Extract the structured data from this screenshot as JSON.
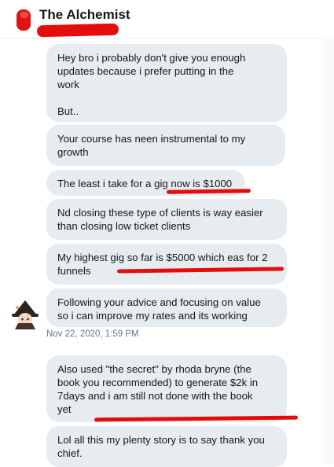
{
  "header": {
    "title": "The Alchemist"
  },
  "messages": [
    {
      "lines": [
        "Hey bro i probably  don't  give you enough",
        "updates  because  i prefer putting  in the",
        "work"
      ],
      "extra": [
        "But.."
      ]
    },
    {
      "lines": [
        "Your course has neen instrumental  to my",
        "growth"
      ]
    },
    {
      "lines": [
        "The least i take for a gig now is $1000"
      ]
    },
    {
      "lines": [
        "Nd closing  these type of clients is way easier",
        "than closing  low ticket clients"
      ]
    },
    {
      "lines": [
        "My highest gig so far is $5000 which eas for 2",
        "funnels"
      ]
    },
    {
      "lines": [
        "Following  your advice and focusing  on value",
        "so i can improve my rates  and its working"
      ]
    },
    {
      "lines": [
        "Also used  \"the secret\" by rhoda bryne (the",
        "book you recommended) to generate $2k in",
        "7days and i am still  not done  with the book",
        "yet"
      ]
    },
    {
      "lines": [
        "Lol all this my plenty story is to say thank  you",
        "chief."
      ]
    }
  ],
  "timestamp": "Nov 22, 2020, 1:59 PM",
  "colors": {
    "bubble": "#e6ecf0",
    "text": "#14171a",
    "muted": "#657786",
    "annotation": "#e50c0c"
  },
  "icons": {
    "header_avatar": "red-profile-icon",
    "sender_avatar": "character-avatar-icon"
  }
}
